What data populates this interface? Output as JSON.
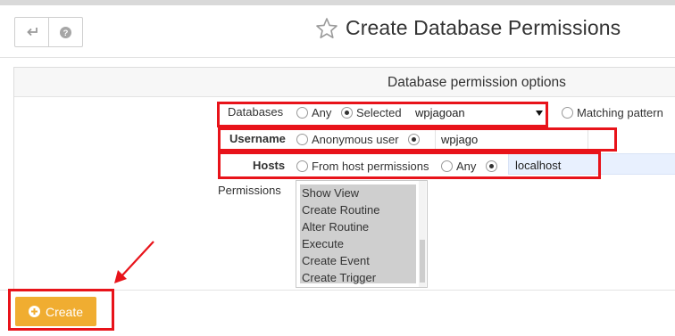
{
  "page": {
    "title": "Create Database Permissions"
  },
  "toolbar": {
    "back_icon": "back-arrow-icon",
    "help_icon": "help-icon",
    "title_icon": "star-outline-icon"
  },
  "panel": {
    "heading": "Database permission options"
  },
  "databases": {
    "label": "Databases",
    "opt_any": "Any",
    "opt_selected": "Selected",
    "selected_value": "wpjagoan",
    "opt_matching": "Matching pattern",
    "checked": "Selected"
  },
  "username": {
    "label": "Username",
    "opt_anonymous": "Anonymous user",
    "value": "wpjago",
    "checked": "custom"
  },
  "hosts": {
    "label": "Hosts",
    "opt_from_host": "From host permissions",
    "opt_any": "Any",
    "value": "localhost",
    "checked": "custom"
  },
  "permissions": {
    "label": "Permissions",
    "items": [
      "Show View",
      "Create Routine",
      "Alter Routine",
      "Execute",
      "Create Event",
      "Create Trigger"
    ]
  },
  "actions": {
    "create_label": "Create",
    "create_icon": "plus-circle-icon"
  },
  "colors": {
    "highlight": "#e8131a",
    "create_button": "#f0ad31"
  }
}
